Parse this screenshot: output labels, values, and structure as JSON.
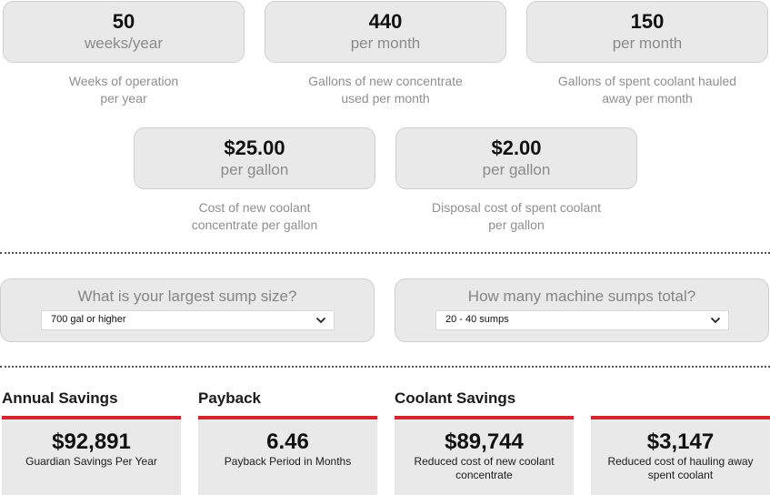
{
  "inputs": [
    {
      "value": "50",
      "unit": "weeks/year",
      "caption_line1": "Weeks of operation",
      "caption_line2": "per year"
    },
    {
      "value": "440",
      "unit": "per month",
      "caption_line1": "Gallons of new concentrate",
      "caption_line2": "used per month"
    },
    {
      "value": "150",
      "unit": "per month",
      "caption_line1": "Gallons of spent coolant hauled",
      "caption_line2": "away per month"
    },
    {
      "value": "$25.00",
      "unit": "per gallon",
      "caption_line1": "Cost of new coolant",
      "caption_line2": "concentrate per gallon"
    },
    {
      "value": "$2.00",
      "unit": "per gallon",
      "caption_line1": "Disposal cost of spent coolant",
      "caption_line2": "per gallon"
    }
  ],
  "selects": [
    {
      "question": "What is your largest sump size?",
      "selected": "700 gal or higher",
      "icon": "chevron-down-icon"
    },
    {
      "question": "How many machine sumps total?",
      "selected": "20 - 40 sumps",
      "icon": "chevron-down-icon"
    }
  ],
  "results": {
    "sections": {
      "annual_savings": "Annual Savings",
      "payback": "Payback",
      "coolant_savings": "Coolant Savings"
    },
    "cards": [
      {
        "value": "$92,891",
        "label": "Guardian Savings Per Year"
      },
      {
        "value": "6.46",
        "label": "Payback Period in Months"
      },
      {
        "value": "$89,744",
        "label": "Reduced cost of new coolant concentrate"
      },
      {
        "value": "$3,147",
        "label": "Reduced cost of hauling away spent coolant"
      }
    ]
  },
  "colors": {
    "accent_red": "#d22630",
    "card_bg": "#e9e9e9",
    "muted_text": "#8a8a8a"
  }
}
